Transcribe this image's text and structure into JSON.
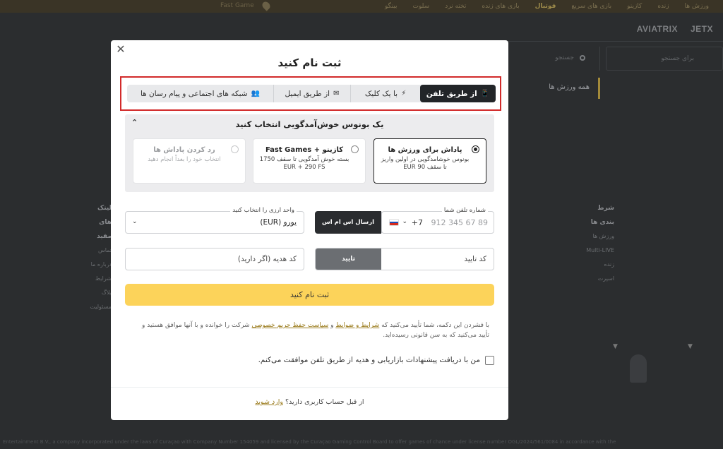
{
  "background": {
    "topnav": [
      "ورزش ها",
      "زنده",
      "کازینو",
      "بازی های سریع",
      "فوتبال",
      "بازی های زنده",
      "تخته نرد",
      "سلوت",
      "بینگو"
    ],
    "topnav_mini": "Fast Game",
    "games": [
      "AVIATRIX",
      "JETX"
    ],
    "search_placeholder": "جستجو",
    "search2_placeholder": "برای جستجو",
    "sports_label": "همه ورزش ها",
    "col1": {
      "head": "لینک های مفید",
      "items": [
        "تماس",
        "درباره ما",
        "شرایط",
        "بلاگ",
        "مسئولیت"
      ]
    },
    "col2": {
      "head": "شرط بندی ها",
      "items": [
        "ورزش ها",
        "Multi-LIVE",
        "زنده",
        "اسپرت"
      ]
    },
    "footer_text": "Entertainment B.V., a company incorporated under the laws of Curaçao with Company Number 154059 and licensed by the Curaçao Gaming Control Board to offer games of chance under license number OGL/2024/561/0084 in accordance with the"
  },
  "modal": {
    "title": "ثبت نام کنید",
    "close_label": "✕",
    "tabs": [
      {
        "label": "از طریق تلفن",
        "icon": "phone-icon",
        "glyph": "📱",
        "active": true
      },
      {
        "label": "با یک کلیک",
        "icon": "lightning-icon",
        "glyph": "⚡",
        "active": false
      },
      {
        "label": "از طریق ایمیل",
        "icon": "envelope-icon",
        "glyph": "✉",
        "active": false
      },
      {
        "label": "شبکه های اجتماعی و پیام رسان ها",
        "icon": "users-icon",
        "glyph": "👥",
        "active": false
      }
    ],
    "bonus": {
      "heading": "یک بونوس خوش‌آمدگویی انتخاب کنید",
      "collapse_glyph": "⌃",
      "options": [
        {
          "title": "پاداش برای ورزش ها",
          "desc": "بونوس خوشامدگویی در اولین واریز تا سقف 90 EUR",
          "selected": true,
          "disabled": false
        },
        {
          "title": "کازینو + Fast Games",
          "desc": "بسته خوش آمدگویی تا سقف 1750 EUR + 290 FS",
          "selected": false,
          "disabled": false
        },
        {
          "title": "رد کردن پاداش ها",
          "desc": "انتخاب خود را بعداً انجام دهید",
          "selected": false,
          "disabled": true
        }
      ]
    },
    "phone": {
      "label": "شماره تلفن شما",
      "country_code": "+7",
      "placeholder": "912 345 67 89",
      "flag_colors": [
        "#ffffff",
        "#1f4fb6",
        "#d52b1e"
      ]
    },
    "sms_button": "ارسال اس ام اس",
    "currency": {
      "label": "واحد ارزی را انتخاب کنید",
      "value": "یورو (EUR)"
    },
    "confirm_code_placeholder": "کد تایید",
    "confirm_button": "تایید",
    "promo_placeholder": "کد هدیه (اگر دارید)",
    "submit_button": "ثبت نام کنید",
    "terms": {
      "before": "با فشردن این دکمه، شما تأیید می‌کنید که ",
      "link1": "شرایط و ضوابط",
      "mid": " و ",
      "link2": "سیاست حفظ حریم خصوصی",
      "after": " شرکت را خوانده و با آنها موافق هستید و تأیید می‌کنید که به سن قانونی رسیده‌اید."
    },
    "consent_text": "من با دریافت پیشنهادات بازاریابی و هدیه از طریق تلفن موافقت می‌کنم.",
    "login": {
      "text": "از قبل حساب کاربری دارید؟ ",
      "link": "وارد شوید"
    },
    "colors": {
      "accent": "#fcd35a",
      "dark": "#222528",
      "highlight_border": "#d22a2a",
      "link": "#9a7b1c"
    }
  }
}
